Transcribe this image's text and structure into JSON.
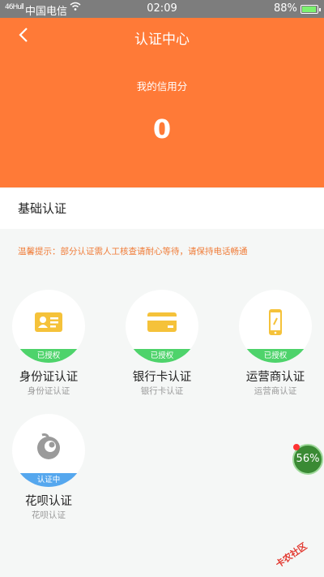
{
  "status_bar": {
    "signal": "46Hull",
    "carrier": "中国电信",
    "time": "02:09",
    "battery_pct": "88%"
  },
  "header": {
    "back_icon": "chevron-left-icon",
    "title": "认证中心",
    "credit_label": "我的信用分",
    "credit_score": "0",
    "bg_color": "#ff7a37"
  },
  "section": {
    "title": "基础认证"
  },
  "tip": "温馨提示：部分认证需人工核查请耐心等待，请保持电话畅通",
  "cards": [
    {
      "icon": "id-card-icon",
      "badge": "已授权",
      "label": "身份证认证",
      "sublabel": "身份证认证",
      "badge_color": "#4ed36b"
    },
    {
      "icon": "bank-card-icon",
      "badge": "已授权",
      "label": "银行卡认证",
      "sublabel": "银行卡认证",
      "badge_color": "#4ed36b"
    },
    {
      "icon": "phone-icon",
      "badge": "已授权",
      "label": "运营商认证",
      "sublabel": "运营商认证",
      "badge_color": "#4ed36b"
    },
    {
      "icon": "huabei-icon",
      "badge": "认证中",
      "label": "花呗认证",
      "sublabel": "花呗认证",
      "badge_color": "#55a7ee"
    }
  ],
  "floating_widget": {
    "value": "56%"
  },
  "watermark": "卡农社区"
}
